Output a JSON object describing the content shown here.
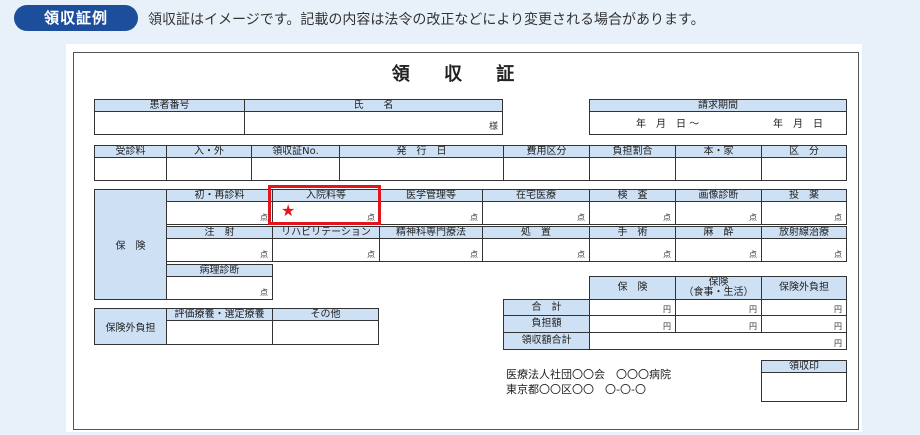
{
  "header": {
    "badge": "領収証例",
    "note": "領収証はイメージです。記載の内容は法令の改正などにより変更される場合があります。"
  },
  "receipt": {
    "title": "領 収 証",
    "top_row": {
      "patient_no": "患者番号",
      "name": "氏　　名",
      "sama": "様",
      "period": "請求期間",
      "period_from": "年　月　日 〜",
      "period_to": "年　月　日"
    },
    "second_row": [
      "受診料",
      "入・外",
      "領収証No.",
      "発　行　日",
      "費用区分",
      "負担割合",
      "本・家",
      "区　分"
    ],
    "insurance_label": "保　険",
    "ins_row1": [
      "初・再診料",
      "入院料等",
      "医学管理等",
      "在宅医療",
      "検　査",
      "画像診断",
      "投　薬"
    ],
    "ins_row2": [
      "注　射",
      "リハビリテーション",
      "精神科専門療法",
      "処　置",
      "手　術",
      "麻　酔",
      "放射線治療"
    ],
    "ins_row3": [
      "病理診断"
    ],
    "unit_ten": "点",
    "jihi": {
      "label": "保険外負担",
      "cols": [
        "評価療養・選定療養",
        "その他"
      ]
    },
    "totals": {
      "cols": [
        "保　険",
        "保険\n（食事・生活）",
        "保険外負担"
      ],
      "rows": [
        "合　計",
        "負担額",
        "領収額合計"
      ],
      "unit_yen": "円"
    },
    "hospital": {
      "line1": "医療法人社団〇〇会　〇〇〇病院",
      "line2": "東京都〇〇区〇〇　〇-〇-〇"
    },
    "stamp": "領収印"
  },
  "highlight": {
    "marker": "★",
    "color": "#e4141c"
  }
}
